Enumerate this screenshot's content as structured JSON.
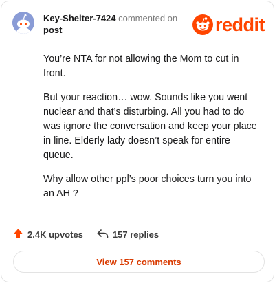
{
  "header": {
    "username": "Key-Shelter-7424",
    "commented_on": "commented on",
    "post_label": "post"
  },
  "brand": {
    "logo_text": "reddit",
    "accent": "#ff4500"
  },
  "comment": {
    "paragraphs": [
      "You’re NTA for not allowing the Mom to cut in front.",
      "But your reaction… wow. Sounds like you went nuclear and that’s disturbing. All you had to do was ignore the conversation and keep your place in line. Elderly lady doesn’t speak for entire queue.",
      "Why allow other ppl’s poor choices turn you into an AH ?"
    ]
  },
  "actions": {
    "upvotes": "2.4K upvotes",
    "upvote_icon": "upvote-arrow-icon",
    "replies": "157 replies",
    "reply_icon": "reply-arrow-icon"
  },
  "footer": {
    "view_comments": "View 157 comments"
  }
}
